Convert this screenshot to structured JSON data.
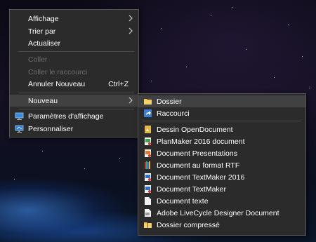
{
  "context_menu": {
    "items": [
      {
        "label": "Affichage",
        "has_submenu": true,
        "disabled": false
      },
      {
        "label": "Trier par",
        "has_submenu": true,
        "disabled": false
      },
      {
        "label": "Actualiser",
        "disabled": false
      },
      {
        "label": "Coller",
        "disabled": true
      },
      {
        "label": "Coller le raccourci",
        "disabled": true
      },
      {
        "label": "Annuler Nouveau",
        "shortcut": "Ctrl+Z",
        "disabled": false
      },
      {
        "label": "Nouveau",
        "has_submenu": true,
        "disabled": false
      },
      {
        "label": "Paramètres d'affichage",
        "icon": "display-settings-icon",
        "disabled": false
      },
      {
        "label": "Personnaliser",
        "icon": "personalize-icon",
        "disabled": false
      }
    ]
  },
  "submenu": {
    "items": [
      {
        "label": "Dossier",
        "icon": "folder-icon"
      },
      {
        "label": "Raccourci",
        "icon": "shortcut-icon"
      },
      {
        "label": "Dessin OpenDocument",
        "icon": "opendocument-drawing-icon"
      },
      {
        "label": "PlanMaker 2016 document",
        "icon": "planmaker-icon"
      },
      {
        "label": "Document Presentations",
        "icon": "presentations-icon"
      },
      {
        "label": "Document au format RTF",
        "icon": "rtf-document-icon"
      },
      {
        "label": "Document TextMaker 2016",
        "icon": "textmaker-2016-icon"
      },
      {
        "label": "Document TextMaker",
        "icon": "textmaker-icon"
      },
      {
        "label": "Document texte",
        "icon": "text-document-icon"
      },
      {
        "label": "Adobe LiveCycle Designer Document",
        "icon": "livecycle-icon"
      },
      {
        "label": "Dossier compressé",
        "icon": "zip-folder-icon"
      }
    ]
  },
  "colors": {
    "menu_bg": "#2b2b2b",
    "menu_border": "#555555",
    "highlight": "#414141",
    "text": "#ffffff",
    "disabled_text": "#6e6e6e"
  }
}
